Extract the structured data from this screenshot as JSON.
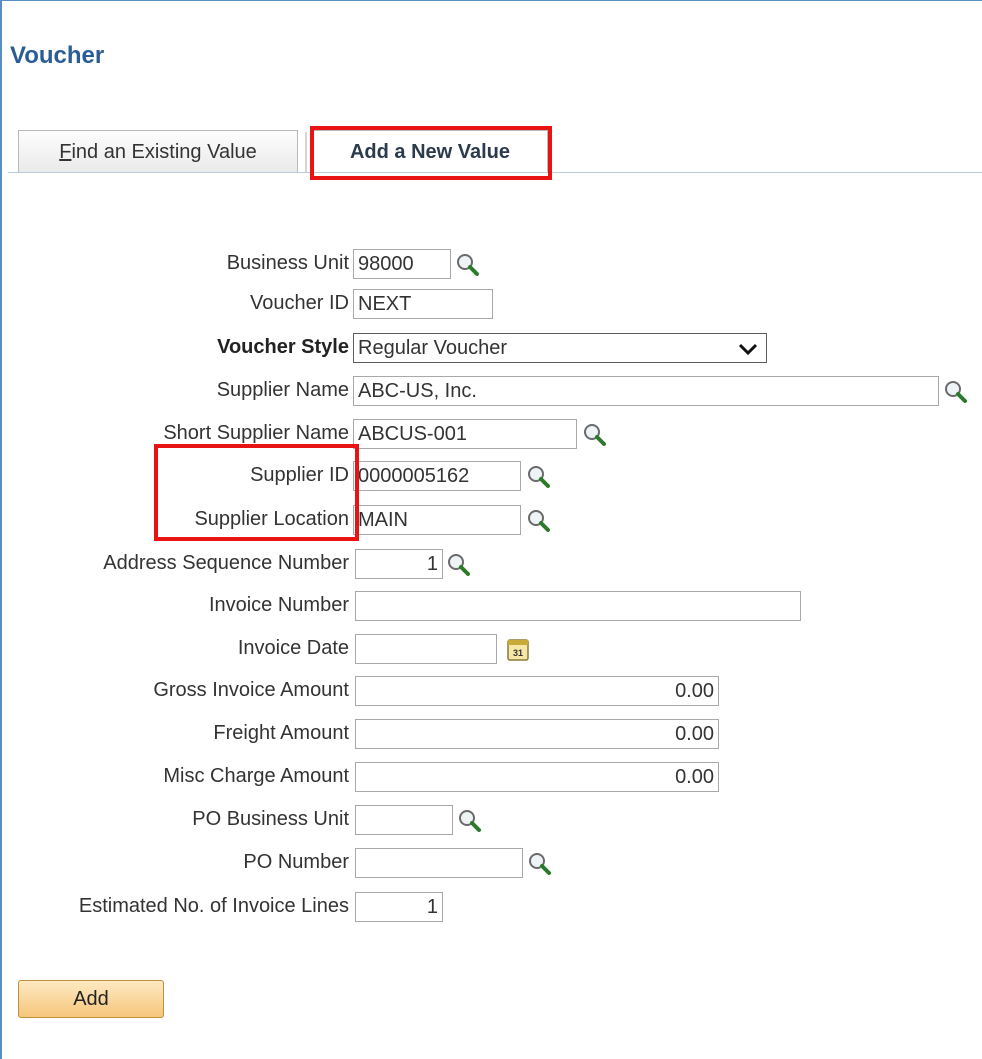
{
  "page": {
    "title": "Voucher"
  },
  "tabs": [
    {
      "label": "Find an Existing Value",
      "accesskey": "F",
      "rest": "ind an Existing Value"
    },
    {
      "label": "Add a New Value"
    }
  ],
  "form": {
    "business_unit": {
      "label": "Business Unit",
      "value": "98000"
    },
    "voucher_id": {
      "label": "Voucher ID",
      "value": "NEXT"
    },
    "voucher_style": {
      "label": "Voucher Style",
      "value": "Regular Voucher"
    },
    "supplier_name": {
      "label": "Supplier Name",
      "value": "ABC-US, Inc."
    },
    "short_supplier_name": {
      "label": "Short Supplier Name",
      "value": "ABCUS-001"
    },
    "supplier_id": {
      "label": "Supplier ID",
      "value": "0000005162"
    },
    "supplier_location": {
      "label": "Supplier Location",
      "value": "MAIN"
    },
    "address_sequence": {
      "label": "Address Sequence Number",
      "value": "1"
    },
    "invoice_number": {
      "label": "Invoice Number",
      "value": ""
    },
    "invoice_date": {
      "label": "Invoice Date",
      "value": "",
      "calendar_text": "31"
    },
    "gross_invoice_amount": {
      "label": "Gross Invoice Amount",
      "value": "0.00"
    },
    "freight_amount": {
      "label": "Freight Amount",
      "value": "0.00"
    },
    "misc_charge_amount": {
      "label": "Misc Charge Amount",
      "value": "0.00"
    },
    "po_business_unit": {
      "label": "PO Business Unit",
      "value": ""
    },
    "po_number": {
      "label": "PO Number",
      "value": ""
    },
    "est_invoice_lines": {
      "label": "Estimated No. of Invoice Lines",
      "value": "1"
    }
  },
  "actions": {
    "add_label": "Add"
  },
  "colors": {
    "title": "#2a5d95",
    "highlight": "#ea1313",
    "button": "#f7c67c",
    "frame": "#5b8ec1"
  },
  "icons": {
    "lookup": "magnifier-icon",
    "calendar": "calendar-icon",
    "dropdown": "chevron-down-icon"
  }
}
